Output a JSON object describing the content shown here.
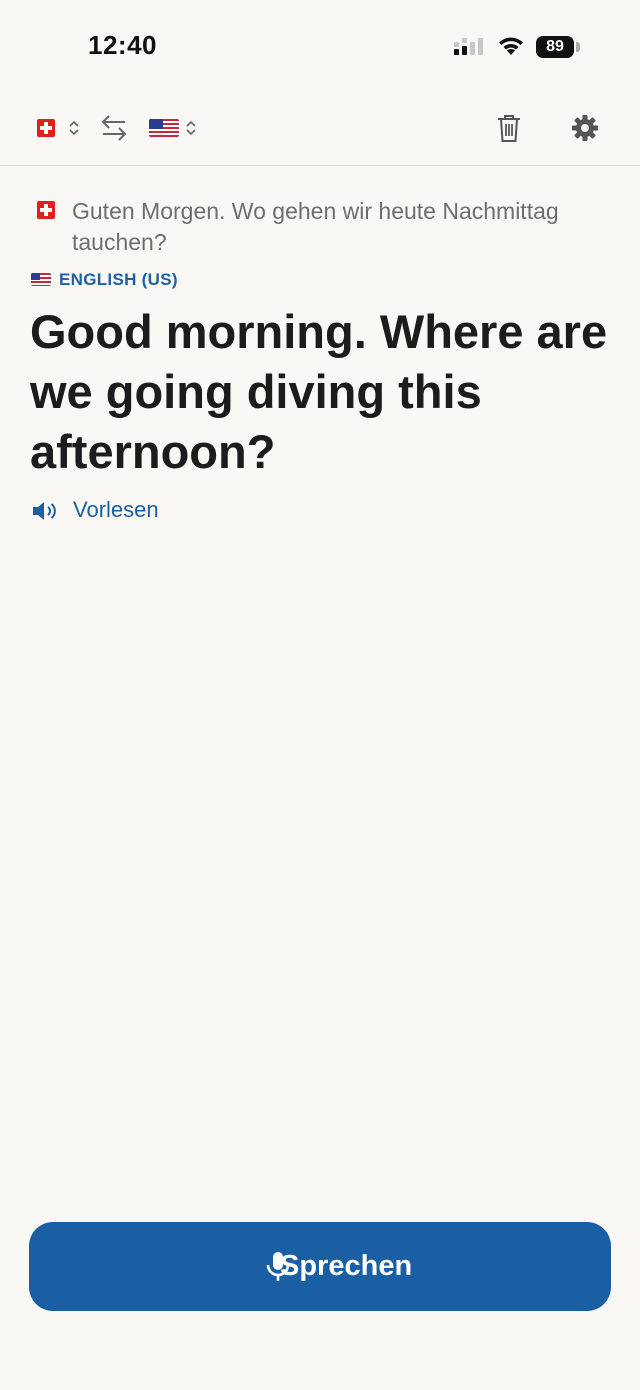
{
  "status_bar": {
    "time": "12:40",
    "battery": "89"
  },
  "toolbar": {
    "source_language_flag": "swiss-flag",
    "target_language_flag": "us-flag",
    "icons": [
      "chevron-updown-icon",
      "swap-arrows-icon",
      "trash-icon",
      "gear-icon"
    ]
  },
  "conversation": {
    "source_text": "Guten Morgen. Wo gehen wir heute Nachmittag tauchen?",
    "target_language_label": "ENGLISH (US)",
    "translation": "Good morning. Where are we going diving this afternoon?",
    "read_aloud_label": "Vorlesen"
  },
  "speak_button": {
    "label": "Sprechen"
  },
  "colors": {
    "background": "#f9f8f4",
    "accent": "#1a5ea3",
    "link": "#1d5fa3",
    "secondary_text": "#6e6e6e"
  }
}
